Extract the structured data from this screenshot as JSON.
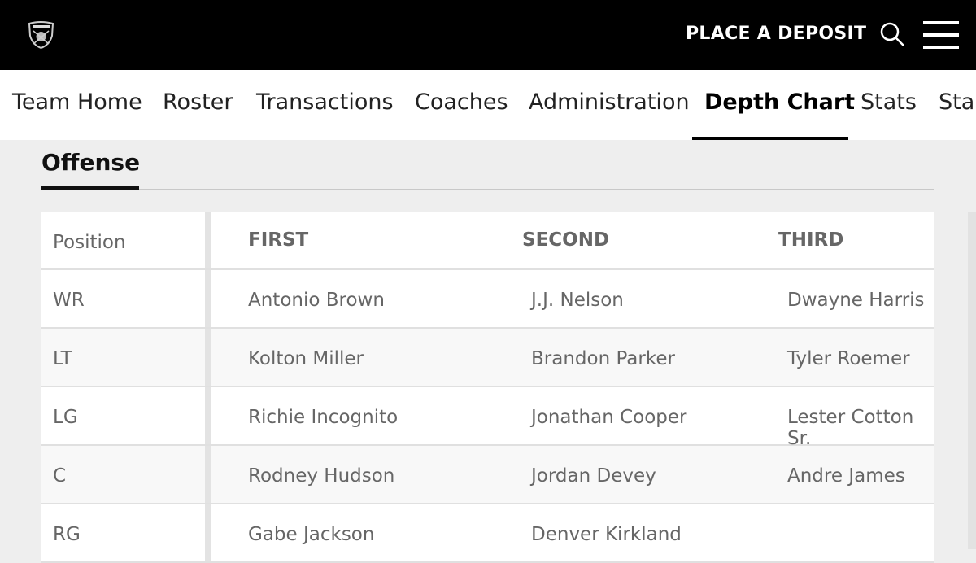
{
  "header": {
    "logo": "RAIDERS",
    "deposit_label": "PLACE A DEPOSIT",
    "icons": [
      "search-icon",
      "hamburger-menu-icon"
    ]
  },
  "nav": {
    "items": [
      "Team Home",
      "Roster",
      "Transactions",
      "Coaches",
      "Administration",
      "Depth Chart",
      "Stats",
      "Standings"
    ],
    "active": "Depth Chart"
  },
  "section": {
    "title": "Offense"
  },
  "table": {
    "headers": [
      "Position",
      "FIRST",
      "SECOND",
      "THIRD"
    ],
    "rows": [
      [
        "WR",
        "Antonio Brown",
        "J.J. Nelson",
        "Dwayne Harris"
      ],
      [
        "LT",
        "Kolton Miller",
        "Brandon Parker",
        "Tyler Roemer"
      ],
      [
        "LG",
        "Richie Incognito",
        "Jonathan Cooper",
        "Lester Cotton Sr."
      ],
      [
        "C",
        "Rodney Hudson",
        "Jordan Devey",
        "Andre James"
      ],
      [
        "RG",
        "Gabe Jackson",
        "Denver Kirkland",
        ""
      ]
    ]
  }
}
